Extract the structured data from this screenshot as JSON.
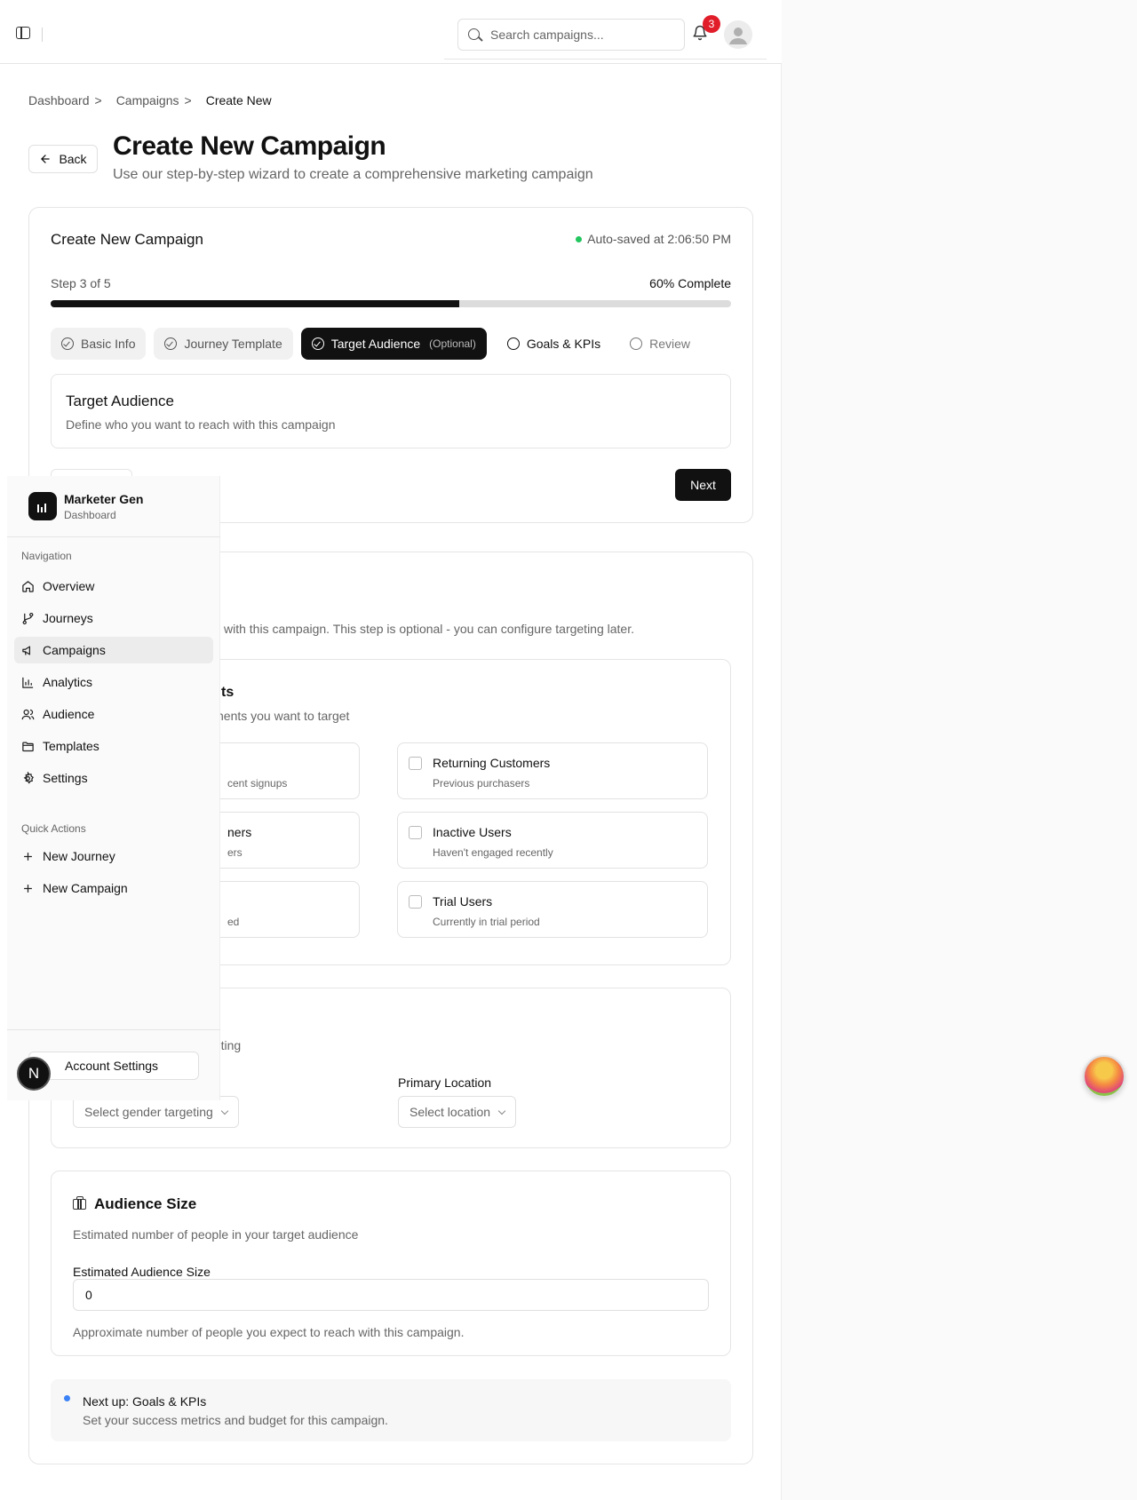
{
  "topbar": {
    "search_placeholder": "Search campaigns...",
    "notification_count": "3"
  },
  "breadcrumb": {
    "items": [
      "Dashboard",
      "Campaigns"
    ],
    "separator": ">",
    "current": "Create New"
  },
  "header": {
    "back_label": "Back",
    "title": "Create New Campaign",
    "subtitle": "Use our step-by-step wizard to create a comprehensive marketing campaign"
  },
  "wizard": {
    "title": "Create New Campaign",
    "autosave": "Auto-saved at 2:06:50 PM",
    "step_label": "Step 3 of 5",
    "percent_label": "60% Complete",
    "progress": 0.6,
    "steps": [
      {
        "label": "Basic Info",
        "state": "done"
      },
      {
        "label": "Journey Template",
        "state": "done"
      },
      {
        "label": "Target Audience",
        "tag": "(Optional)",
        "state": "active"
      },
      {
        "label": "Goals & KPIs",
        "state": "todo"
      },
      {
        "label": "Review",
        "state": "future"
      }
    ],
    "section_title": "Target Audience",
    "section_desc": "Define who you want to reach with this campaign",
    "next_label": "Next"
  },
  "main": {
    "desc_visible": "with this campaign. This step is optional - you can configure targeting later.",
    "segments": {
      "title_visible": "ts",
      "desc_visible": "nents you want to target",
      "options_left": [
        {
          "title": "",
          "desc": "cent signups"
        },
        {
          "title": "ners",
          "desc": "ers"
        },
        {
          "title": "",
          "desc": "ed"
        }
      ],
      "options_right": [
        {
          "title": "Returning Customers",
          "desc": "Previous purchasers"
        },
        {
          "title": "Inactive Users",
          "desc": "Haven't engaged recently"
        },
        {
          "title": "Trial Users",
          "desc": "Currently in trial period"
        }
      ]
    },
    "demographics": {
      "desc_visible": "geting",
      "gender_placeholder": "Select gender targeting",
      "location_label": "Primary Location",
      "location_placeholder": "Select location"
    },
    "audience_size": {
      "title": "Audience Size",
      "desc": "Estimated number of people in your target audience",
      "label": "Estimated Audience Size",
      "value": "0",
      "help": "Approximate number of people you expect to reach with this campaign."
    },
    "next_up": {
      "title": "Next up: Goals & KPIs",
      "desc": "Set your success metrics and budget for this campaign."
    }
  },
  "sidebar": {
    "brand_name": "Marketer Gen",
    "brand_sub": "Dashboard",
    "nav_section": "Navigation",
    "nav": [
      "Overview",
      "Journeys",
      "Campaigns",
      "Analytics",
      "Audience",
      "Templates",
      "Settings"
    ],
    "active": "Campaigns",
    "quick_section": "Quick Actions",
    "quick": [
      "New Journey",
      "New Campaign"
    ],
    "account_label": "Account Settings",
    "avatar_letter": "N"
  }
}
